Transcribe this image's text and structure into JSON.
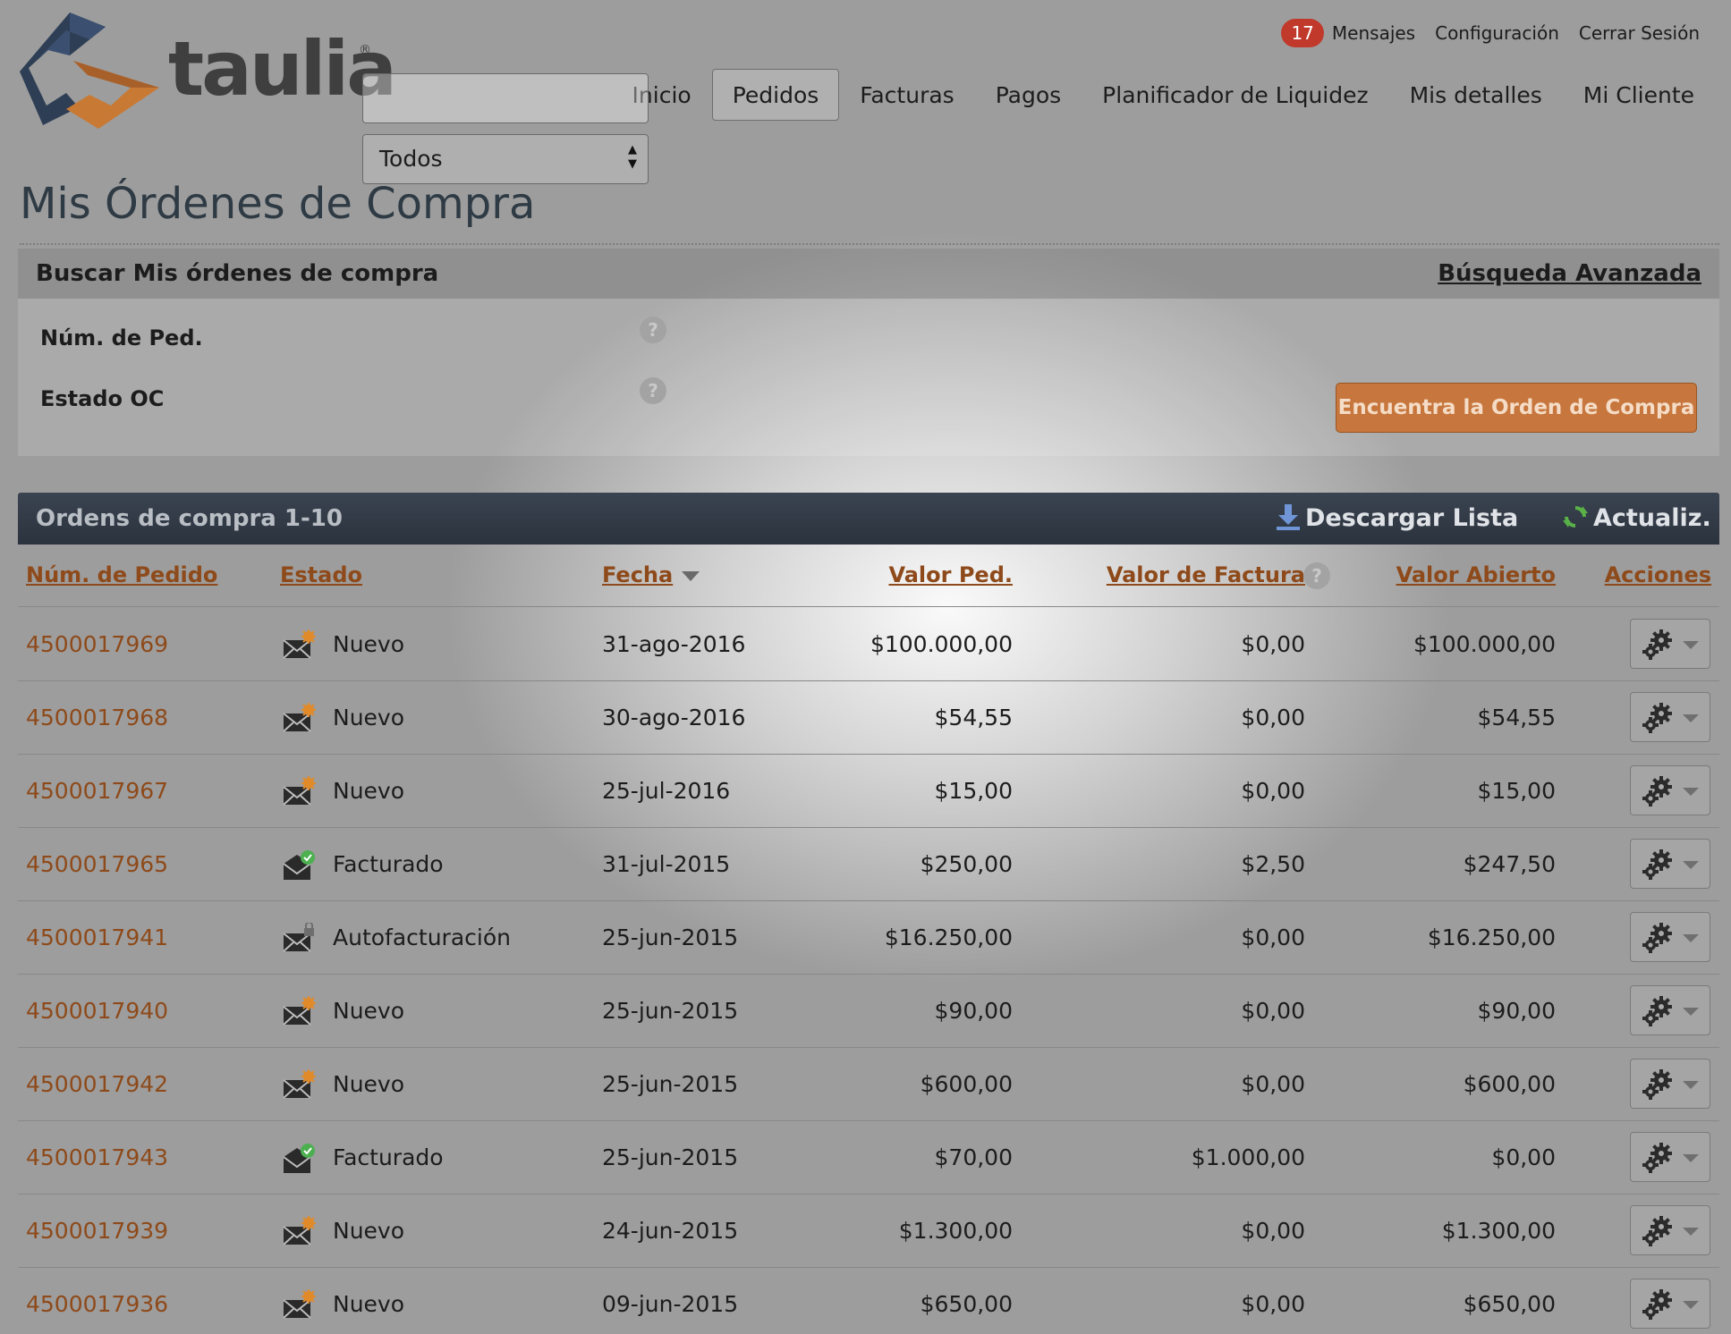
{
  "brand": {
    "name": "taulia",
    "reg_mark": "®"
  },
  "topbar": {
    "messages_count": "17",
    "messages_label": "Mensajes",
    "config_label": "Configuración",
    "logout_label": "Cerrar Sesión"
  },
  "nav": {
    "items": [
      "Inicio",
      "Pedidos",
      "Facturas",
      "Pagos",
      "Planificador de Liquidez",
      "Mis detalles",
      "Mi Cliente"
    ],
    "active": "Pedidos"
  },
  "page": {
    "title": "Mis Órdenes de Compra"
  },
  "search": {
    "title": "Buscar Mis órdenes de compra",
    "advanced_label": "Búsqueda Avanzada",
    "order_number_label": "Núm. de Ped.",
    "order_number_value": "",
    "status_label": "Estado OC",
    "status_value": "Todos",
    "help_glyph": "?",
    "find_button": "Encuentra la Orden de Compra"
  },
  "list": {
    "title": "Ordens de compra 1-10",
    "download_label": "Descargar Lista",
    "refresh_label": "Actualiz.",
    "columns": {
      "order_number": "Núm. de Pedido",
      "status": "Estado",
      "date": "Fecha",
      "order_value": "Valor Ped.",
      "invoice_value": "Valor de Factura",
      "open_value": "Valor Abierto",
      "actions": "Acciones"
    },
    "sort": {
      "column": "Fecha",
      "direction": "desc"
    },
    "rows": [
      {
        "id": "4500017969",
        "status": "Nuevo",
        "status_icon": "new-envelope-icon",
        "date": "31-ago-2016",
        "order_value": "$100.000,00",
        "invoice_value": "$0,00",
        "open_value": "$100.000,00"
      },
      {
        "id": "4500017968",
        "status": "Nuevo",
        "status_icon": "new-envelope-icon",
        "date": "30-ago-2016",
        "order_value": "$54,55",
        "invoice_value": "$0,00",
        "open_value": "$54,55"
      },
      {
        "id": "4500017967",
        "status": "Nuevo",
        "status_icon": "new-envelope-icon",
        "date": "25-jul-2016",
        "order_value": "$15,00",
        "invoice_value": "$0,00",
        "open_value": "$15,00"
      },
      {
        "id": "4500017965",
        "status": "Facturado",
        "status_icon": "invoiced-envelope-icon",
        "date": "31-jul-2015",
        "order_value": "$250,00",
        "invoice_value": "$2,50",
        "open_value": "$247,50"
      },
      {
        "id": "4500017941",
        "status": "Autofacturación",
        "status_icon": "self-billing-envelope-icon",
        "date": "25-jun-2015",
        "order_value": "$16.250,00",
        "invoice_value": "$0,00",
        "open_value": "$16.250,00"
      },
      {
        "id": "4500017940",
        "status": "Nuevo",
        "status_icon": "new-envelope-icon",
        "date": "25-jun-2015",
        "order_value": "$90,00",
        "invoice_value": "$0,00",
        "open_value": "$90,00"
      },
      {
        "id": "4500017942",
        "status": "Nuevo",
        "status_icon": "new-envelope-icon",
        "date": "25-jun-2015",
        "order_value": "$600,00",
        "invoice_value": "$0,00",
        "open_value": "$600,00"
      },
      {
        "id": "4500017943",
        "status": "Facturado",
        "status_icon": "invoiced-envelope-icon",
        "date": "25-jun-2015",
        "order_value": "$70,00",
        "invoice_value": "$1.000,00",
        "open_value": "$0,00"
      },
      {
        "id": "4500017939",
        "status": "Nuevo",
        "status_icon": "new-envelope-icon",
        "date": "24-jun-2015",
        "order_value": "$1.300,00",
        "invoice_value": "$0,00",
        "open_value": "$1.300,00"
      },
      {
        "id": "4500017936",
        "status": "Nuevo",
        "status_icon": "new-envelope-icon",
        "date": "09-jun-2015",
        "order_value": "$650,00",
        "invoice_value": "$0,00",
        "open_value": "$650,00"
      }
    ]
  },
  "colors": {
    "accent_orange": "#c7763d",
    "link_brown": "#8e4a1a",
    "header_dark": "#2f3742",
    "badge_red": "#c0392b",
    "logo_blue": "#2e3f55",
    "logo_orange": "#c87a34"
  }
}
